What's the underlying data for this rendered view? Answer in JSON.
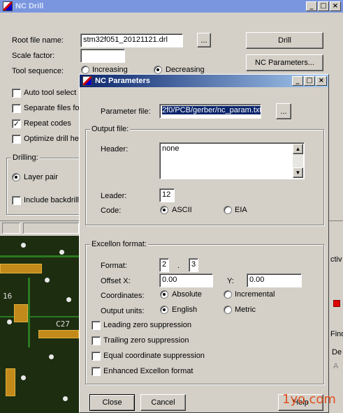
{
  "nc_drill": {
    "title": "NC Drill",
    "root_file_label": "Root file name:",
    "root_file_value": "stm32f051_20121121.drl",
    "browse_label": "...",
    "drill_button": "Drill",
    "scale_label": "Scale factor:",
    "scale_value": "",
    "nc_params_button": "NC Parameters...",
    "tool_seq_label": "Tool sequence:",
    "tool_seq_increasing": "Increasing",
    "tool_seq_decreasing": "Decreasing",
    "checks": [
      {
        "label": "Auto tool select",
        "checked": false
      },
      {
        "label": "Separate files for",
        "checked": false
      },
      {
        "label": "Repeat codes",
        "checked": true
      },
      {
        "label": "Optimize drill hea",
        "checked": false
      }
    ],
    "drilling_group": "Drilling:",
    "layer_pair": "Layer pair",
    "include_backdrill": "Include backdrill"
  },
  "nc_params": {
    "title": "NC Parameters",
    "param_file_label": "Parameter file:",
    "param_file_value": "2f0/PCB/gerber/nc_param.txt",
    "browse_label": "...",
    "output_group": "Output file:",
    "header_label": "Header:",
    "header_value": "none",
    "leader_label": "Leader:",
    "leader_value": "12",
    "code_label": "Code:",
    "code_ascii": "ASCII",
    "code_eia": "EIA",
    "excellon_group": "Excellon format:",
    "format_label": "Format:",
    "format_int": "2",
    "format_sep": ".",
    "format_dec": "3",
    "offset_x_label": "Offset X:",
    "offset_x_value": "0.00",
    "offset_y_label": "Y:",
    "offset_y_value": "0.00",
    "coords_label": "Coordinates:",
    "coords_absolute": "Absolute",
    "coords_incremental": "Incremental",
    "units_label": "Output units:",
    "units_english": "English",
    "units_metric": "Metric",
    "checks": [
      {
        "label": "Leading zero suppression",
        "checked": false
      },
      {
        "label": "Trailing zero suppression",
        "checked": false
      },
      {
        "label": "Equal coordinate suppression",
        "checked": false
      },
      {
        "label": "Enhanced Excellon format",
        "checked": false
      }
    ],
    "close_button": "Close",
    "cancel_button": "Cancel",
    "help_button": "Help"
  },
  "caption_buttons": {
    "minimize": "_",
    "maximize": "□",
    "close": "×"
  },
  "pcb_labels": {
    "left": "16",
    "right": "C27"
  },
  "right_strip": {
    "text1": "ctiv",
    "text2": "Find",
    "text3": "De",
    "text4": "A"
  },
  "watermark": "1yo.com"
}
